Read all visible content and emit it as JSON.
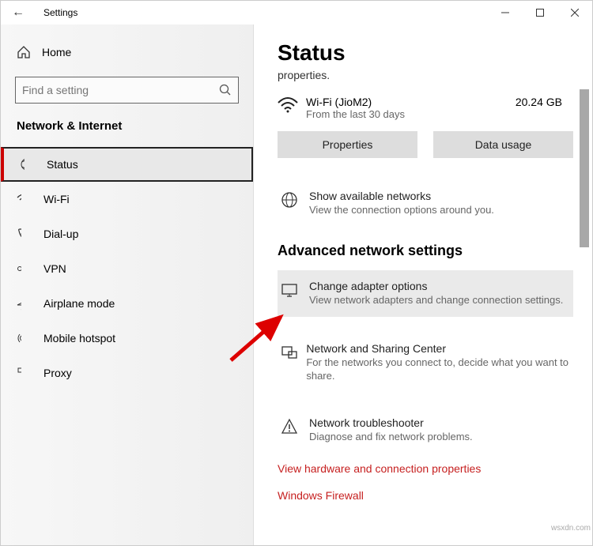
{
  "window": {
    "title": "Settings"
  },
  "sidebar": {
    "home": "Home",
    "search_placeholder": "Find a setting",
    "section": "Network & Internet",
    "items": [
      {
        "label": "Status"
      },
      {
        "label": "Wi-Fi"
      },
      {
        "label": "Dial-up"
      },
      {
        "label": "VPN"
      },
      {
        "label": "Airplane mode"
      },
      {
        "label": "Mobile hotspot"
      },
      {
        "label": "Proxy"
      }
    ]
  },
  "content": {
    "heading": "Status",
    "subheading": "properties.",
    "wifi": {
      "name": "Wi-Fi (JioM2)",
      "period": "From the last 30 days",
      "usage": "20.24 GB"
    },
    "buttons": {
      "props": "Properties",
      "data": "Data usage"
    },
    "available": {
      "title": "Show available networks",
      "desc": "View the connection options around you."
    },
    "adv_heading": "Advanced network settings",
    "adapter": {
      "title": "Change adapter options",
      "desc": "View network adapters and change connection settings."
    },
    "sharing": {
      "title": "Network and Sharing Center",
      "desc": "For the networks you connect to, decide what you want to share."
    },
    "trouble": {
      "title": "Network troubleshooter",
      "desc": "Diagnose and fix network problems."
    },
    "link1": "View hardware and connection properties",
    "link2": "Windows Firewall"
  },
  "watermark": "wsxdn.com"
}
